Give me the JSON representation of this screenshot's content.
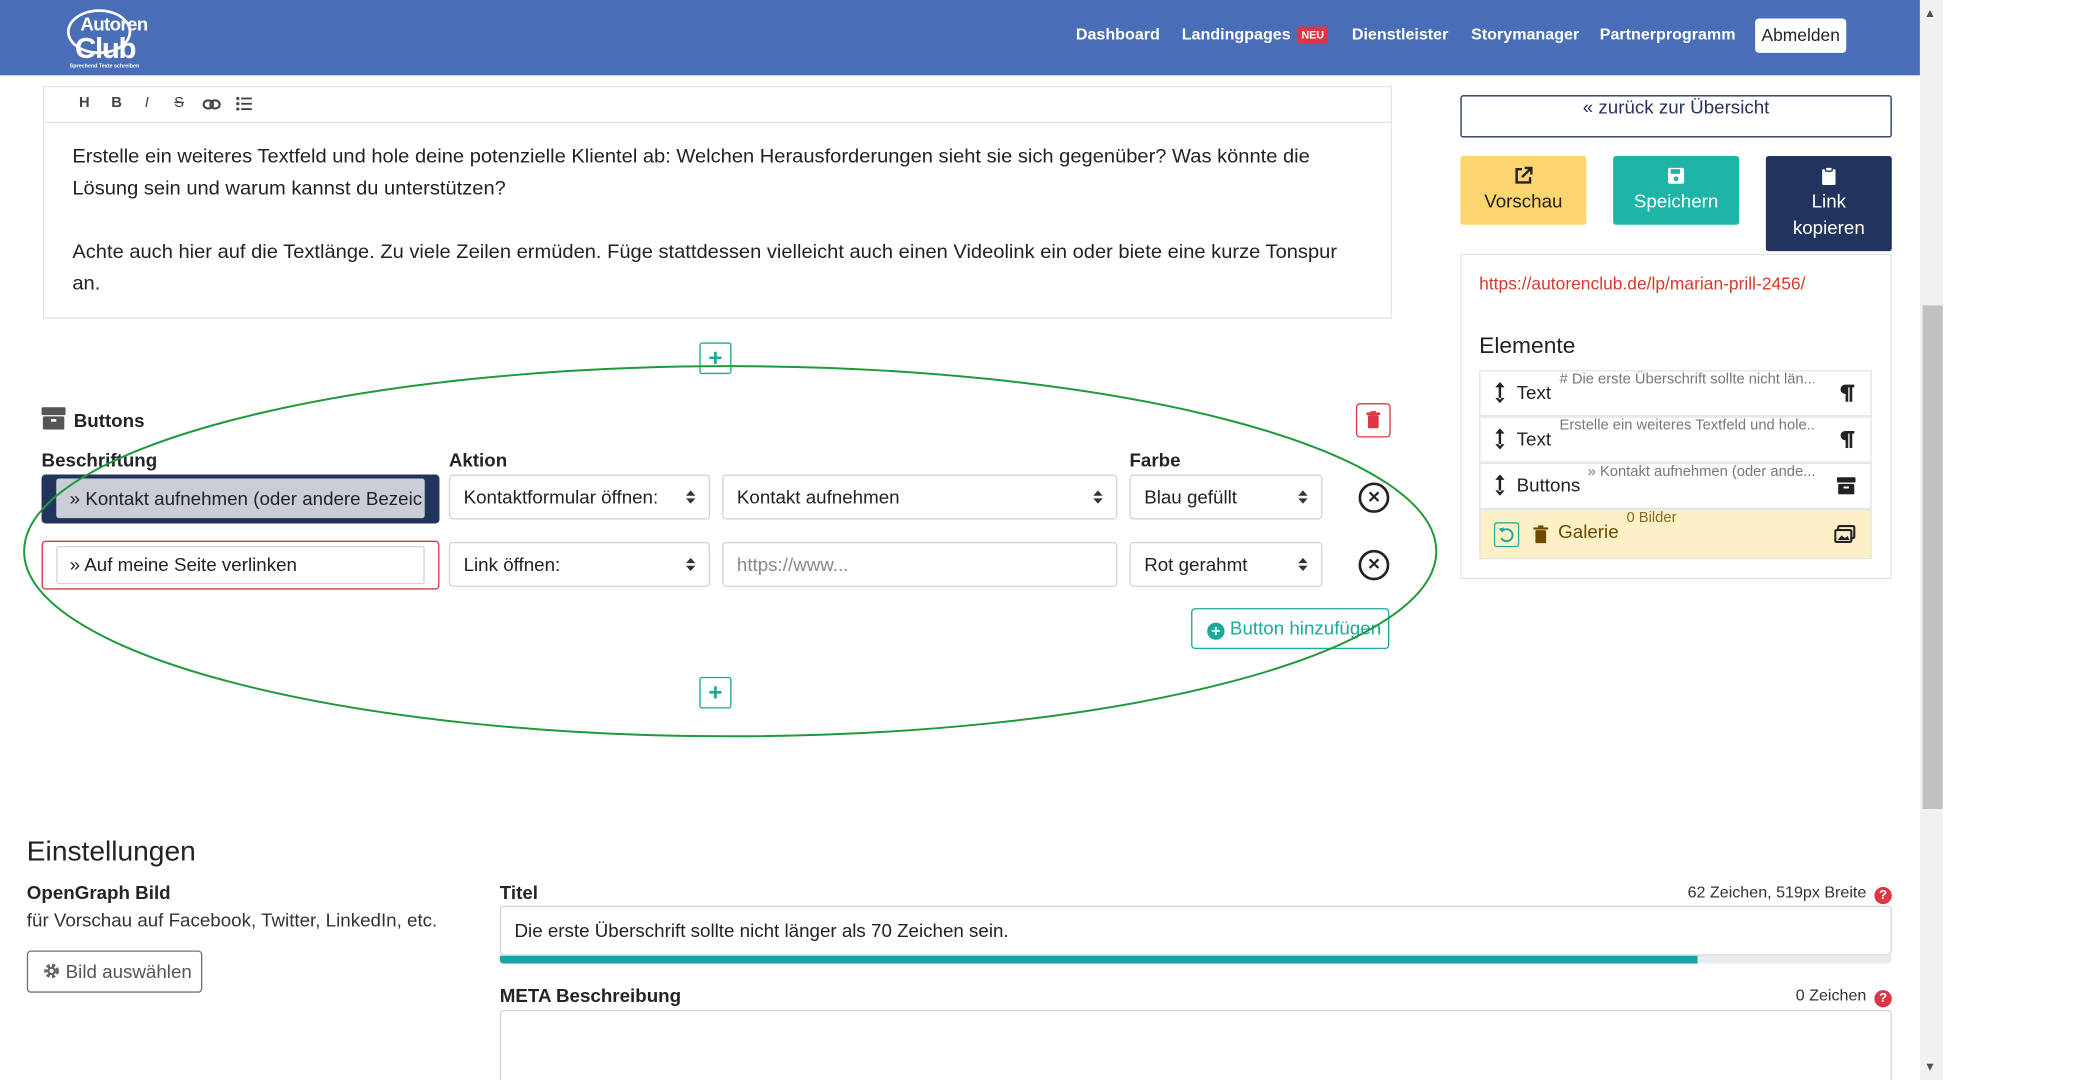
{
  "nav": {
    "logo": {
      "line1": "Autoren",
      "line2": "Club",
      "tagline": "Sprechend Texte schreiben"
    },
    "items": [
      "Dashboard",
      "Landingpages",
      "Dienstleister",
      "Storymanager",
      "Partnerprogramm"
    ],
    "badge_new": "NEU",
    "logout": "Abmelden"
  },
  "editor": {
    "toolbar": {
      "heading": "H",
      "bold": "B",
      "italic": "I",
      "strike": "S"
    },
    "paragraphs": [
      "Erstelle ein weiteres Textfeld und hole deine potenzielle Klientel ab: Welchen Herausforderungen sieht sie sich gegenüber? Was könnte die Lösung sein und warum kannst du unterstützen?",
      "Achte auch hier auf die Textlänge. Zu viele Zeilen ermüden. Füge stattdessen vielleicht auch einen Videolink ein oder biete eine kurze Tonspur an."
    ]
  },
  "buttons_block": {
    "title": "Buttons",
    "headers": {
      "caption": "Beschriftung",
      "action": "Aktion",
      "color": "Farbe"
    },
    "rows": [
      {
        "caption": "» Kontakt aufnehmen (oder andere Bezeic",
        "action": "Kontaktformular öffnen:",
        "target": "Kontakt aufnehmen",
        "color": "Blau gefüllt"
      },
      {
        "caption": "» Auf meine Seite verlinken",
        "action": "Link öffnen:",
        "target_placeholder": "https://www...",
        "color": "Rot gerahmt"
      }
    ],
    "add_label": "Button hinzufügen",
    "plus": "+"
  },
  "settings": {
    "title": "Einstellungen",
    "og_title": "OpenGraph Bild",
    "og_sub": "für Vorschau auf Facebook, Twitter, LinkedIn, etc.",
    "og_button": "Bild auswählen",
    "title_label": "Titel",
    "title_meta": "62 Zeichen, 519px Breite",
    "title_value": "Die erste Überschrift sollte nicht länger als 70 Zeichen sein.",
    "title_progress": 0.86,
    "meta_label": "META Beschreibung",
    "meta_count": "0 Zeichen",
    "help": "?"
  },
  "sidebar": {
    "back": "« zurück zur Übersicht",
    "preview": "Vorschau",
    "save": "Speichern",
    "copy_line1": "Link",
    "copy_line2": "kopieren",
    "url": "https://autorenclub.de/lp/marian-prill-2456/",
    "elements_title": "Elemente",
    "elements": [
      {
        "name": "Text",
        "preview": "# Die erste Überschrift sollte nicht län..."
      },
      {
        "name": "Text",
        "preview": "Erstelle ein weiteres Textfeld und hole..."
      },
      {
        "name": "Buttons",
        "preview": "» Kontakt aufnehmen (oder ande..."
      },
      {
        "name": "Galerie",
        "preview": "0 Bilder"
      }
    ]
  },
  "colors": {
    "navbar": "#4a6db8",
    "teal": "#1eb5a6",
    "navy": "#22345e",
    "yellow": "#fbd56d",
    "red": "#dc3545",
    "annotation": "#1f9a3a"
  }
}
